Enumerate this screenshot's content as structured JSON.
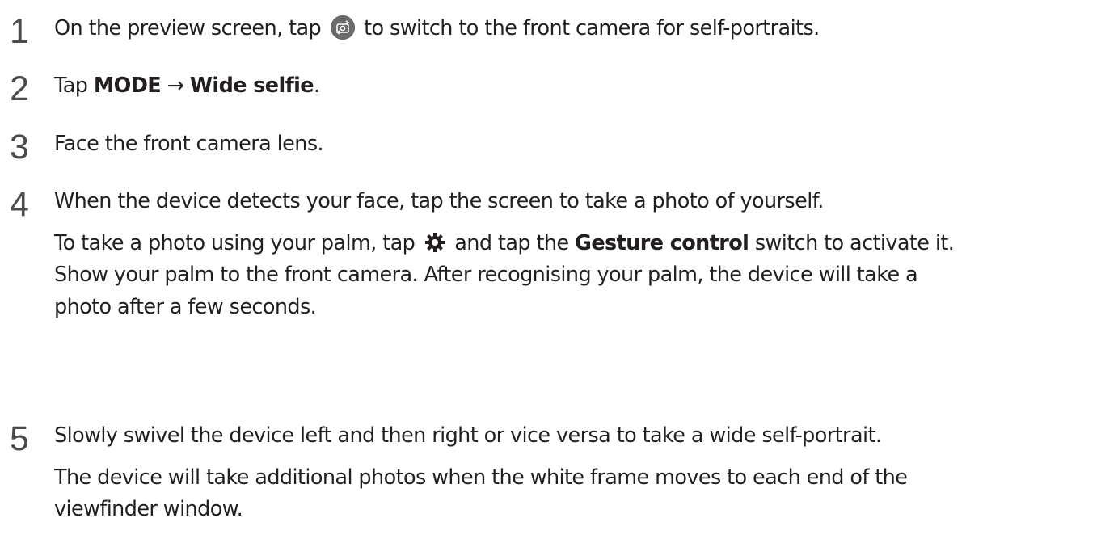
{
  "steps": [
    {
      "number": "1",
      "text_before_icon": "On the preview screen, tap",
      "text_after_icon": "to switch to the front camera for self-portraits."
    },
    {
      "number": "2",
      "prefix": "Tap ",
      "bold_1": "MODE",
      "arrow": " → ",
      "bold_2": "Wide selfie",
      "suffix": "."
    },
    {
      "number": "3",
      "text": "Face the front camera lens."
    },
    {
      "number": "4",
      "text": "When the device detects your face, tap the screen to take a photo of yourself.",
      "note_before_icon": "To take a photo using your palm, tap",
      "note_between": "and tap the ",
      "note_bold": "Gesture control",
      "note_after": " switch to activate it.",
      "note_line2": "Show your palm to the front camera. After recognising your palm, the device will take a",
      "note_line3": "photo after a few seconds."
    },
    {
      "number": "5",
      "text": "Slowly swivel the device left and then right or vice versa to take a wide self-portrait.",
      "note_line1": "The device will take additional photos when the white frame moves to each end of the",
      "note_line2": "viewfinder window."
    }
  ],
  "icons": {
    "camera_switch": "camera-switch-icon",
    "settings": "gear-icon"
  },
  "colors": {
    "text": "#231f20",
    "step_number": "#4a4a4a",
    "icon_fill": "#6a6a6a"
  }
}
